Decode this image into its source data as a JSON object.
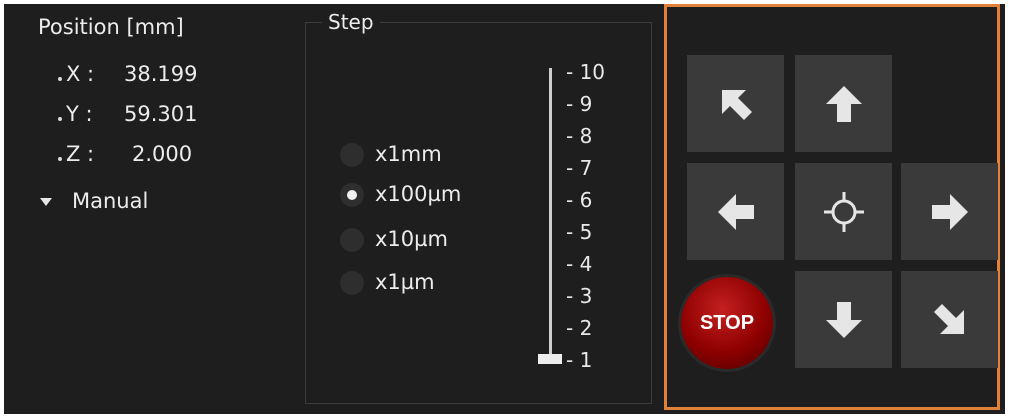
{
  "position": {
    "title": "Position [mm]",
    "axes": [
      {
        "label": "X :",
        "value": "38.199"
      },
      {
        "label": "Y :",
        "value": "59.301"
      },
      {
        "label": "Z :",
        "value": "2.000"
      }
    ],
    "mode_label": "Manual"
  },
  "step": {
    "title": "Step",
    "options": [
      {
        "label": "x1mm",
        "selected": false
      },
      {
        "label": "x100µm",
        "selected": true
      },
      {
        "label": "x10µm",
        "selected": false
      },
      {
        "label": "x1µm",
        "selected": false
      }
    ],
    "slider": {
      "ticks": [
        "10",
        "9",
        "8",
        "7",
        "6",
        "5",
        "4",
        "3",
        "2",
        "1"
      ],
      "value": 1,
      "min": 1,
      "max": 10
    }
  },
  "jog": {
    "stop_label": "STOP",
    "accent_color": "#e2823a",
    "buttons": [
      {
        "name": "up-left",
        "icon": "arrow-up-left-icon"
      },
      {
        "name": "up",
        "icon": "arrow-up-icon"
      },
      {
        "name": "left",
        "icon": "arrow-left-icon"
      },
      {
        "name": "center",
        "icon": "crosshair-icon"
      },
      {
        "name": "right",
        "icon": "arrow-right-icon"
      },
      {
        "name": "down",
        "icon": "arrow-down-icon"
      },
      {
        "name": "down-right",
        "icon": "arrow-down-right-icon"
      }
    ]
  }
}
